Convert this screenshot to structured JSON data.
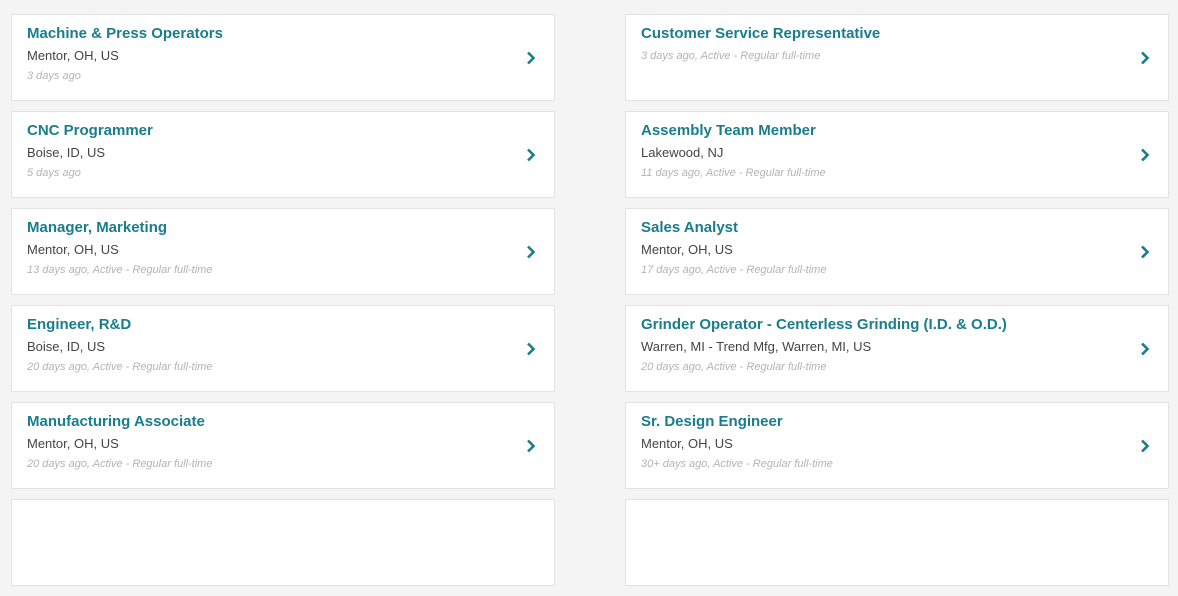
{
  "colors": {
    "accent": "#1a7d8c",
    "text": "#444444",
    "muted": "#b3b3b3",
    "background": "#f4f4f4"
  },
  "icons": {
    "chevron": "chevron-right-icon"
  },
  "jobs_left": [
    {
      "title": "Machine & Press Operators",
      "location": "Mentor, OH, US",
      "meta": "3 days ago"
    },
    {
      "title": "CNC Programmer",
      "location": "Boise, ID, US",
      "meta": "5 days ago"
    },
    {
      "title": "Manager, Marketing",
      "location": "Mentor, OH, US",
      "meta": "13 days ago, Active - Regular full-time"
    },
    {
      "title": "Engineer, R&D",
      "location": "Boise, ID, US",
      "meta": "20 days ago, Active - Regular full-time"
    },
    {
      "title": "Manufacturing Associate",
      "location": "Mentor, OH, US",
      "meta": "20 days ago, Active - Regular full-time"
    },
    {
      "title": "",
      "location": "",
      "meta": ""
    }
  ],
  "jobs_right": [
    {
      "title": "Customer Service Representative",
      "location": "",
      "meta": "3 days ago, Active - Regular full-time"
    },
    {
      "title": "Assembly Team Member",
      "location": "Lakewood, NJ",
      "meta": "11 days ago, Active - Regular full-time"
    },
    {
      "title": "Sales Analyst",
      "location": "Mentor, OH, US",
      "meta": "17 days ago, Active - Regular full-time"
    },
    {
      "title": "Grinder Operator - Centerless Grinding (I.D. & O.D.)",
      "location": "Warren, MI - Trend Mfg, Warren, MI, US",
      "meta": "20 days ago, Active - Regular full-time"
    },
    {
      "title": "Sr. Design Engineer",
      "location": "Mentor, OH, US",
      "meta": "30+ days ago, Active - Regular full-time"
    },
    {
      "title": "",
      "location": "",
      "meta": ""
    }
  ]
}
